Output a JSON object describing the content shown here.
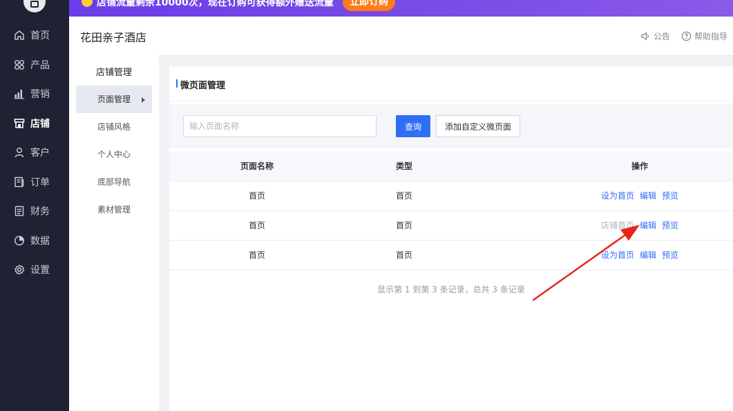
{
  "banner": {
    "text": "店铺流量剩余10000次，现在订购可获得额外赠送流量",
    "button": "立即订购",
    "colors": {
      "bg": "#6a3de8",
      "button": "#ff7a1a"
    }
  },
  "sidebar": {
    "items": [
      {
        "label": "首页",
        "icon": "home-icon"
      },
      {
        "label": "产品",
        "icon": "grid-icon"
      },
      {
        "label": "营销",
        "icon": "bar-chart-icon"
      },
      {
        "label": "店铺",
        "icon": "store-icon",
        "active": true
      },
      {
        "label": "客户",
        "icon": "user-icon"
      },
      {
        "label": "订单",
        "icon": "order-icon"
      },
      {
        "label": "财务",
        "icon": "finance-icon"
      },
      {
        "label": "数据",
        "icon": "pie-chart-icon"
      },
      {
        "label": "设置",
        "icon": "gear-icon"
      }
    ]
  },
  "header": {
    "store_name": "花田亲子酒店",
    "notice": "公告",
    "help": "帮助指导"
  },
  "submenu": {
    "title": "店铺管理",
    "items": [
      {
        "label": "页面管理",
        "active": true
      },
      {
        "label": "店铺风格"
      },
      {
        "label": "个人中心"
      },
      {
        "label": "底部导航"
      },
      {
        "label": "素材管理"
      }
    ]
  },
  "main": {
    "title": "微页面管理",
    "search": {
      "placeholder": "输入页面名称",
      "value": ""
    },
    "query_button": "查询",
    "add_button": "添加自定义微页面",
    "table": {
      "columns": [
        "页面名称",
        "类型",
        "操作"
      ],
      "rows": [
        {
          "name": "首页",
          "type": "首页",
          "set_home": "设为首页",
          "set_home_disabled": false,
          "edit": "编辑",
          "preview": "预览"
        },
        {
          "name": "首页",
          "type": "首页",
          "set_home": "店铺首页",
          "set_home_disabled": true,
          "edit": "编辑",
          "preview": "预览"
        },
        {
          "name": "首页",
          "type": "首页",
          "set_home": "设为首页",
          "set_home_disabled": false,
          "edit": "编辑",
          "preview": "预览"
        }
      ]
    },
    "pagination_info": "显示第 1 到第 3 条记录，总共 3 条记录"
  },
  "accent_color": "#2f6ef5",
  "annotation_color": "#e8241c"
}
